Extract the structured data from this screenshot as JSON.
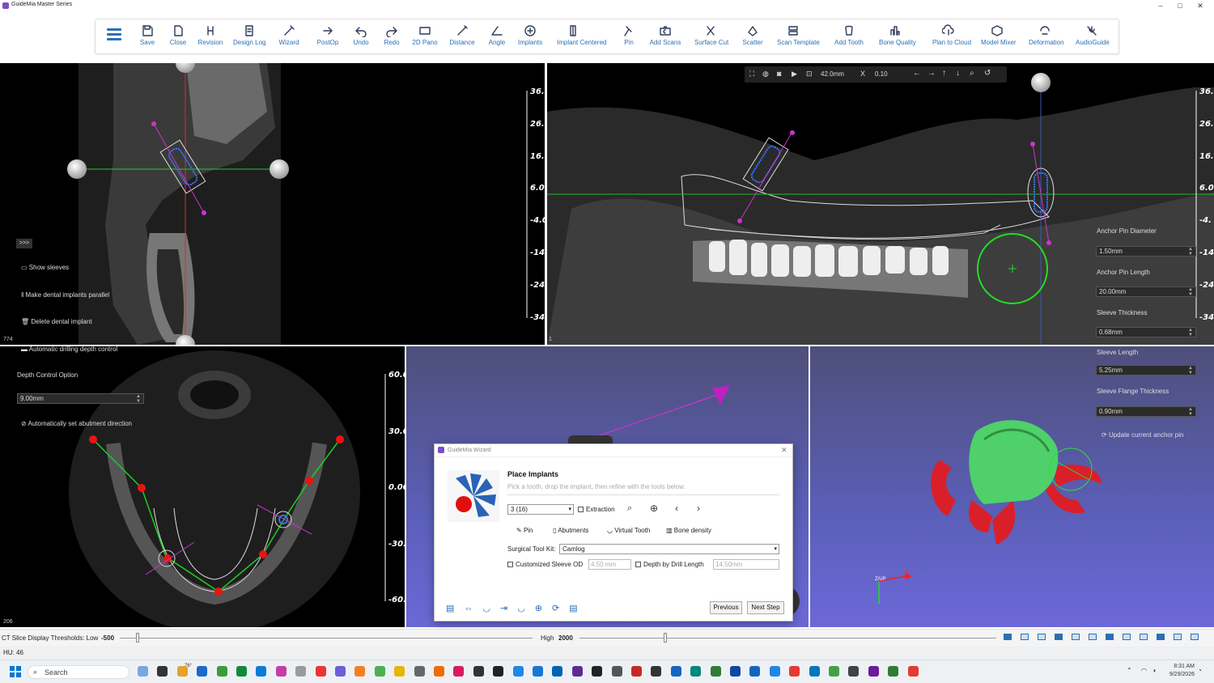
{
  "app": {
    "title": "GuideMia Master Series"
  },
  "window_controls": {
    "minimize": "–",
    "maximize": "□",
    "close": "✕"
  },
  "toolbar": {
    "items": [
      {
        "label": "Save",
        "icon": "save-icon"
      },
      {
        "label": "Close",
        "icon": "close-file-icon"
      },
      {
        "label": "Revision",
        "icon": "revision-icon"
      },
      {
        "label": "Design Log",
        "icon": "design-log-icon"
      },
      {
        "label": "Wizard",
        "icon": "wizard-icon"
      },
      {
        "label": "PostOp",
        "icon": "postop-icon"
      },
      {
        "label": "Undo",
        "icon": "undo-icon"
      },
      {
        "label": "Redo",
        "icon": "redo-icon"
      },
      {
        "label": "2D Pano",
        "icon": "pano-icon"
      },
      {
        "label": "Distance",
        "icon": "distance-icon"
      },
      {
        "label": "Angle",
        "icon": "angle-icon"
      },
      {
        "label": "Implants",
        "icon": "implants-icon"
      },
      {
        "label": "Implant Centered",
        "icon": "implant-centered-icon"
      },
      {
        "label": "Pin",
        "icon": "pin-icon"
      },
      {
        "label": "Add Scans",
        "icon": "add-scans-icon"
      },
      {
        "label": "Surface Cut",
        "icon": "surface-cut-icon"
      },
      {
        "label": "Scatter",
        "icon": "scatter-icon"
      },
      {
        "label": "Scan Template",
        "icon": "scan-template-icon"
      },
      {
        "label": "Add Tooth",
        "icon": "add-tooth-icon"
      },
      {
        "label": "Bone Quality",
        "icon": "bone-quality-icon"
      },
      {
        "label": "Plan to Cloud",
        "icon": "cloud-icon"
      },
      {
        "label": "Model Mixer",
        "icon": "model-mixer-icon"
      },
      {
        "label": "Deformation",
        "icon": "deformation-icon"
      },
      {
        "label": "AudioGuide",
        "icon": "audioguide-icon"
      }
    ]
  },
  "left_panel": {
    "expand": ">>>",
    "show_sleeves": "Show sleeves",
    "make_parallel": "Make dental implants parallel",
    "delete_implant": "Delete dental implant",
    "auto_depth": "Automatic drilling depth control",
    "depth_option_label": "Depth Control Option",
    "depth_value": "9.00mm",
    "auto_abutment": "Automatically set abutment direction",
    "slice_top": "774",
    "slice_bottom": "206"
  },
  "pano_view": {
    "toolbar_zoom": "42.0mm",
    "toolbar_scale_label": "X",
    "toolbar_scale": "0.10",
    "slice_number": "1",
    "ruler_ticks": [
      "36.0",
      "26.0",
      "16.0",
      "6.00",
      "-4.0",
      "-14.",
      "-24.",
      "-34."
    ],
    "ruler_ticks_right": [
      "36.",
      "26.",
      "16.",
      "6.0",
      "-4.",
      "-14",
      "-24",
      "-34"
    ]
  },
  "axial_view": {
    "ruler_ticks": [
      "60.0",
      "30.0",
      "0.00",
      "-30.",
      "-60."
    ]
  },
  "right_panel": {
    "anchor_pin_diameter_label": "Anchor Pin Diameter",
    "anchor_pin_diameter": "1.50mm",
    "anchor_pin_length_label": "Anchor Pin Length",
    "anchor_pin_length": "20.00mm",
    "sleeve_thickness_label": "Sleeve Thickness",
    "sleeve_thickness": "0.68mm",
    "sleeve_length_label": "Sleeve Length",
    "sleeve_length": "5.25mm",
    "sleeve_flange_label": "Sleeve Flange Thickness",
    "sleeve_flange": "0.90mm",
    "update_anchor": "Update current anchor pin"
  },
  "view3d": {
    "axis_x": "X/RT",
    "axis_z": "Z/UP"
  },
  "wizard": {
    "title": "GuideMia Wizard",
    "heading": "Place Implants",
    "subtitle": "Pick a tooth, drop the implant, then refine with the tools below.",
    "tooth_select": "3   (16)",
    "extraction": "Extraction",
    "pin": "Pin",
    "abutments": "Abutments",
    "virtual_tooth": "Virtual Tooth",
    "bone_density": "Bone density",
    "kit_label": "Surgical Tool Kit:",
    "kit_value": "Camlog",
    "customized_sleeve": "Customized Sleeve OD",
    "sleeve_od": "4.50 mm",
    "depth_by_drill": "Depth by Drill Length",
    "drill_length": "14.50mm",
    "previous": "Previous",
    "next": "Next Step"
  },
  "status": {
    "threshold_label": "CT Slice Display Thresholds: Low",
    "low_value": "-500",
    "high_label": "High",
    "high_value": "2000",
    "hu": "HU: 46"
  },
  "taskbar": {
    "search": "Search",
    "weather": "76°",
    "time": "8:31 AM",
    "date": "9/29/2026"
  }
}
